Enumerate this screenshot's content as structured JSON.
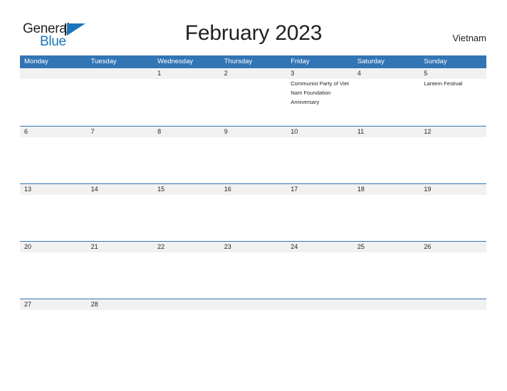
{
  "brand": {
    "name_part1": "General",
    "name_part2": "Blue",
    "triangle_icon": "blue-triangle-icon",
    "colors": {
      "dark": "#231f20",
      "blue": "#1b75bb"
    }
  },
  "header": {
    "title": "February 2023",
    "country": "Vietnam"
  },
  "calendar": {
    "header_color": "#3275b5",
    "number_row_color": "#f1f1f1",
    "weekdays": [
      "Monday",
      "Tuesday",
      "Wednesday",
      "Thursday",
      "Friday",
      "Saturday",
      "Sunday"
    ],
    "weeks": [
      [
        {
          "date": "",
          "event": ""
        },
        {
          "date": "",
          "event": ""
        },
        {
          "date": "1",
          "event": ""
        },
        {
          "date": "2",
          "event": ""
        },
        {
          "date": "3",
          "event": "Communist Party of Viet Nam Foundation Anniversary"
        },
        {
          "date": "4",
          "event": ""
        },
        {
          "date": "5",
          "event": "Lantern Festival"
        }
      ],
      [
        {
          "date": "6",
          "event": ""
        },
        {
          "date": "7",
          "event": ""
        },
        {
          "date": "8",
          "event": ""
        },
        {
          "date": "9",
          "event": ""
        },
        {
          "date": "10",
          "event": ""
        },
        {
          "date": "11",
          "event": ""
        },
        {
          "date": "12",
          "event": ""
        }
      ],
      [
        {
          "date": "13",
          "event": ""
        },
        {
          "date": "14",
          "event": ""
        },
        {
          "date": "15",
          "event": ""
        },
        {
          "date": "16",
          "event": ""
        },
        {
          "date": "17",
          "event": ""
        },
        {
          "date": "18",
          "event": ""
        },
        {
          "date": "19",
          "event": ""
        }
      ],
      [
        {
          "date": "20",
          "event": ""
        },
        {
          "date": "21",
          "event": ""
        },
        {
          "date": "22",
          "event": ""
        },
        {
          "date": "23",
          "event": ""
        },
        {
          "date": "24",
          "event": ""
        },
        {
          "date": "25",
          "event": ""
        },
        {
          "date": "26",
          "event": ""
        }
      ],
      [
        {
          "date": "27",
          "event": ""
        },
        {
          "date": "28",
          "event": ""
        },
        {
          "date": "",
          "event": ""
        },
        {
          "date": "",
          "event": ""
        },
        {
          "date": "",
          "event": ""
        },
        {
          "date": "",
          "event": ""
        },
        {
          "date": "",
          "event": ""
        }
      ]
    ]
  }
}
